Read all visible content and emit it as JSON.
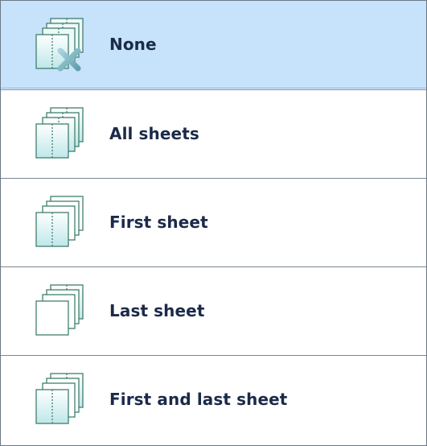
{
  "options": [
    {
      "label": "None",
      "icon": "sheets-none-icon",
      "selected": true
    },
    {
      "label": "All sheets",
      "icon": "sheets-all-icon",
      "selected": false
    },
    {
      "label": "First sheet",
      "icon": "sheets-first-icon",
      "selected": false
    },
    {
      "label": "Last sheet",
      "icon": "sheets-last-icon",
      "selected": false
    },
    {
      "label": "First and last sheet",
      "icon": "sheets-first-last-icon",
      "selected": false
    }
  ],
  "colors": {
    "selected_background": "#c7e2fb",
    "label_text": "#1b2a4a",
    "sheet_outline": "#3f7f6b",
    "sheet_fill": "#cfeeee",
    "remove_cross": "#79b8c4"
  }
}
